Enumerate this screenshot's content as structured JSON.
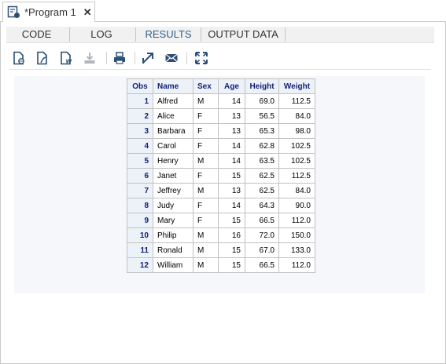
{
  "document_tab": {
    "title": "*Program 1",
    "close": "✕",
    "icon": "program-icon"
  },
  "tabs": [
    {
      "label": "CODE"
    },
    {
      "label": "LOG"
    },
    {
      "label": "RESULTS",
      "active": true
    },
    {
      "label": "OUTPUT DATA"
    }
  ],
  "toolbar": [
    {
      "name": "download-html-icon"
    },
    {
      "name": "download-pdf-icon"
    },
    {
      "name": "download-word-icon"
    },
    {
      "name": "download-icon",
      "disabled": true
    },
    {
      "name": "print-icon"
    },
    {
      "name": "open-new-window-icon"
    },
    {
      "name": "email-icon"
    },
    {
      "name": "maximize-icon"
    }
  ],
  "colors": {
    "accent": "#30608c",
    "header_text": "#112277",
    "header_bg": "#edf2f9",
    "results_bg": "#f5f7fb"
  },
  "table": {
    "columns": [
      "Obs",
      "Name",
      "Sex",
      "Age",
      "Height",
      "Weight"
    ],
    "rows": [
      [
        "1",
        "Alfred",
        "M",
        "14",
        "69.0",
        "112.5"
      ],
      [
        "2",
        "Alice",
        "F",
        "13",
        "56.5",
        "84.0"
      ],
      [
        "3",
        "Barbara",
        "F",
        "13",
        "65.3",
        "98.0"
      ],
      [
        "4",
        "Carol",
        "F",
        "14",
        "62.8",
        "102.5"
      ],
      [
        "5",
        "Henry",
        "M",
        "14",
        "63.5",
        "102.5"
      ],
      [
        "6",
        "Janet",
        "F",
        "15",
        "62.5",
        "112.5"
      ],
      [
        "7",
        "Jeffrey",
        "M",
        "13",
        "62.5",
        "84.0"
      ],
      [
        "8",
        "Judy",
        "F",
        "14",
        "64.3",
        "90.0"
      ],
      [
        "9",
        "Mary",
        "F",
        "15",
        "66.5",
        "112.0"
      ],
      [
        "10",
        "Philip",
        "M",
        "16",
        "72.0",
        "150.0"
      ],
      [
        "11",
        "Ronald",
        "M",
        "15",
        "67.0",
        "133.0"
      ],
      [
        "12",
        "William",
        "M",
        "15",
        "66.5",
        "112.0"
      ]
    ]
  }
}
